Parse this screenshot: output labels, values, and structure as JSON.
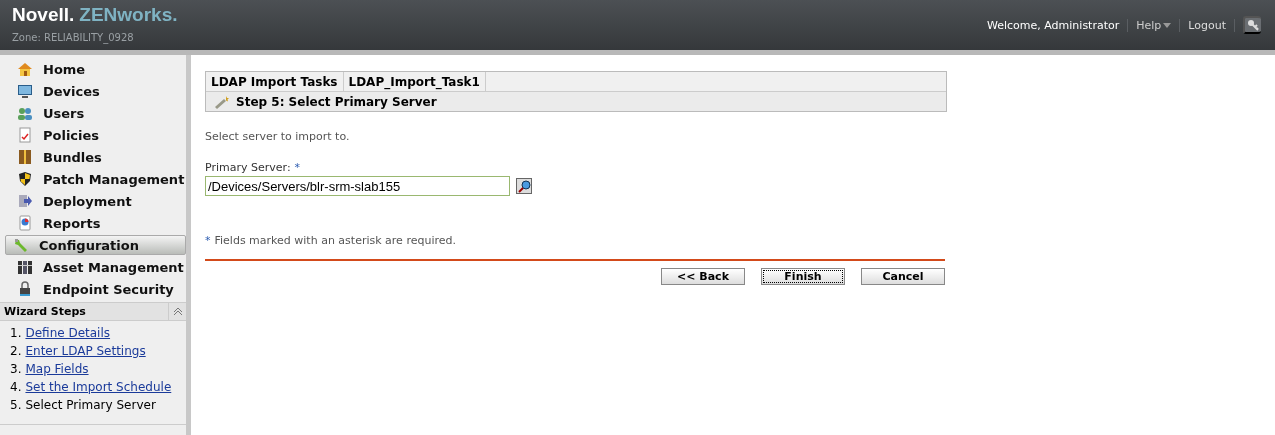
{
  "header": {
    "brand": "Novell.",
    "product": "ZENworks.",
    "zone": "Zone: RELIABILITY_0928",
    "welcome": "Welcome, Administrator",
    "help": "Help",
    "logout": "Logout"
  },
  "nav": [
    {
      "label": "Home",
      "selected": false
    },
    {
      "label": "Devices",
      "selected": false
    },
    {
      "label": "Users",
      "selected": false
    },
    {
      "label": "Policies",
      "selected": false
    },
    {
      "label": "Bundles",
      "selected": false
    },
    {
      "label": "Patch Management",
      "selected": false
    },
    {
      "label": "Deployment",
      "selected": false
    },
    {
      "label": "Reports",
      "selected": false
    },
    {
      "label": "Configuration",
      "selected": true
    },
    {
      "label": "Asset Management",
      "selected": false
    },
    {
      "label": "Endpoint Security",
      "selected": false
    }
  ],
  "wizard": {
    "title": "Wizard Steps",
    "steps": [
      {
        "number": "1.",
        "label": "Define Details",
        "kind": "link"
      },
      {
        "number": "2.",
        "label": "Enter LDAP Settings",
        "kind": "link"
      },
      {
        "number": "3.",
        "label": "Map Fields",
        "kind": "link"
      },
      {
        "number": "4.",
        "label": "Set the Import Schedule",
        "kind": "link"
      },
      {
        "number": "5.",
        "label": "Select Primary Server",
        "kind": "current"
      }
    ]
  },
  "breadcrumb": [
    "LDAP Import Tasks",
    "LDAP_Import_Task1"
  ],
  "step_title": "Step 5: Select Primary Server",
  "instruction": "Select server to import to.",
  "field": {
    "label": "Primary Server:",
    "required_mark": "*",
    "value": "/Devices/Servers/blr-srm-slab155"
  },
  "note": {
    "mark": "*",
    "text": "Fields marked with an asterisk are required."
  },
  "buttons": [
    {
      "label": "<< Back",
      "focused": false
    },
    {
      "label": "Finish",
      "focused": true
    },
    {
      "label": "Cancel",
      "focused": false
    }
  ]
}
